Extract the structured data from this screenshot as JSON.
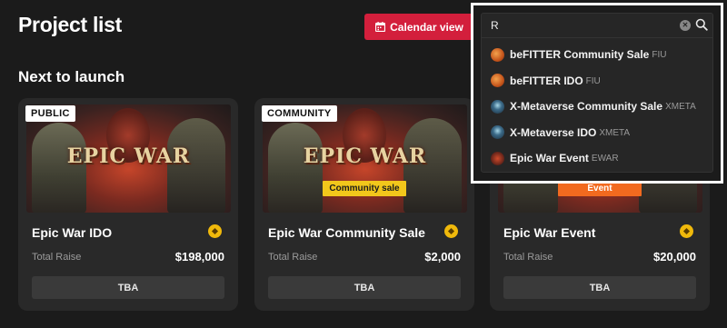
{
  "header": {
    "title": "Project list",
    "calendar_button": "Calendar view"
  },
  "section": {
    "title": "Next to launch"
  },
  "cards": [
    {
      "tag": "PUBLIC",
      "logo": "EPIC WAR",
      "ribbon": "",
      "name": "Epic War IDO",
      "raise_label": "Total Raise",
      "raise_value": "$198,000",
      "status": "TBA"
    },
    {
      "tag": "COMMUNITY",
      "logo": "EPIC WAR",
      "ribbon": "Community sale",
      "name": "Epic War Community Sale",
      "raise_label": "Total Raise",
      "raise_value": "$2,000",
      "status": "TBA"
    },
    {
      "tag": "",
      "logo": "",
      "ribbon": "Event",
      "name": "Epic War Event",
      "raise_label": "Total Raise",
      "raise_value": "$20,000",
      "status": "TBA"
    }
  ],
  "search": {
    "value": "R",
    "results": [
      {
        "name": "beFITTER Community Sale",
        "symbol": "FIU",
        "icon": "befitter-logo"
      },
      {
        "name": "beFITTER IDO",
        "symbol": "FIU",
        "icon": "befitter-logo"
      },
      {
        "name": "X-Metaverse Community Sale",
        "symbol": "XMETA",
        "icon": "xmetaverse-logo"
      },
      {
        "name": "X-Metaverse IDO",
        "symbol": "XMETA",
        "icon": "xmetaverse-logo"
      },
      {
        "name": "Epic War Event",
        "symbol": "EWAR",
        "icon": "epicwar-logo"
      }
    ]
  },
  "colors": {
    "background": "#1b1b1b",
    "card": "#292929",
    "accent": "#d31f3c",
    "ribbon_community": "#f2c71b",
    "ribbon_event": "#f26a1f",
    "coin": "#f0b90b"
  }
}
